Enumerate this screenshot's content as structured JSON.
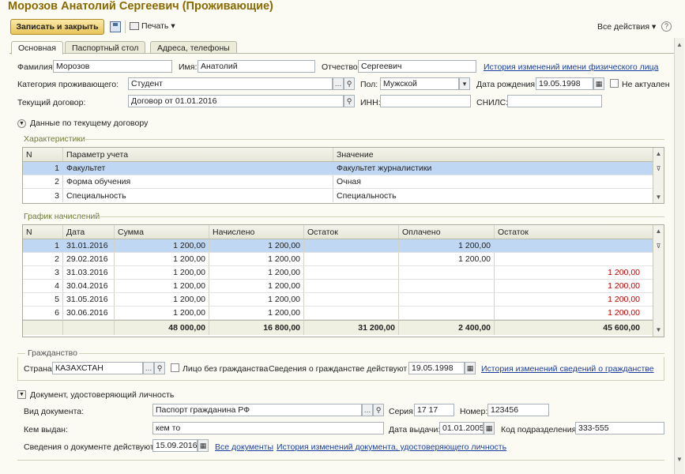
{
  "title": "Морозов Анатолий Сергеевич (Проживающие)",
  "toolbar": {
    "save_close": "Записать и закрыть",
    "print": "Печать",
    "all_actions": "Все действия",
    "help": "?"
  },
  "tabs": [
    "Основная",
    "Паспортный стол",
    "Адреса, телефоны"
  ],
  "person": {
    "lastname_label": "Фамилия:",
    "lastname": "Морозов",
    "firstname_label": "Имя:",
    "firstname": "Анатолий",
    "patronymic_label": "Отчество:",
    "patronymic": "Сергеевич",
    "name_history_link": "История изменений имени физического лица",
    "category_label": "Категория проживающего:",
    "category": "Студент",
    "gender_label": "Пол:",
    "gender": "Мужской",
    "birth_label": "Дата рождения:",
    "birth": "19.05.1998",
    "inactive_label": "Не актуален",
    "contract_label": "Текущий договор:",
    "contract": "Договор  от 01.01.2016",
    "inn_label": "ИНН:",
    "inn": "",
    "snils_label": "СНИЛС:",
    "snils": ""
  },
  "contract_section": "Данные по текущему договору",
  "characteristics": {
    "title": "Характеристики",
    "headers": [
      "N",
      "Параметр учета",
      "Значение"
    ],
    "rows": [
      {
        "n": "1",
        "param": "Факультет",
        "value": "Факультет журналистики"
      },
      {
        "n": "2",
        "param": "Форма обучения",
        "value": "Очная"
      },
      {
        "n": "3",
        "param": "Специальность",
        "value": "Специальность"
      }
    ]
  },
  "schedule": {
    "title": "График начислений",
    "headers": [
      "N",
      "Дата",
      "Сумма",
      "Начислено",
      "Остаток",
      "Оплачено",
      "Остаток"
    ],
    "rows": [
      {
        "n": "1",
        "date": "31.01.2016",
        "sum": "1 200,00",
        "charged": "1 200,00",
        "rest1": "",
        "paid": "1 200,00",
        "rest2": ""
      },
      {
        "n": "2",
        "date": "29.02.2016",
        "sum": "1 200,00",
        "charged": "1 200,00",
        "rest1": "",
        "paid": "1 200,00",
        "rest2": ""
      },
      {
        "n": "3",
        "date": "31.03.2016",
        "sum": "1 200,00",
        "charged": "1 200,00",
        "rest1": "",
        "paid": "",
        "rest2": "1 200,00"
      },
      {
        "n": "4",
        "date": "30.04.2016",
        "sum": "1 200,00",
        "charged": "1 200,00",
        "rest1": "",
        "paid": "",
        "rest2": "1 200,00"
      },
      {
        "n": "5",
        "date": "31.05.2016",
        "sum": "1 200,00",
        "charged": "1 200,00",
        "rest1": "",
        "paid": "",
        "rest2": "1 200,00"
      },
      {
        "n": "6",
        "date": "30.06.2016",
        "sum": "1 200,00",
        "charged": "1 200,00",
        "rest1": "",
        "paid": "",
        "rest2": "1 200,00"
      }
    ],
    "totals": {
      "sum": "48 000,00",
      "charged": "16 800,00",
      "rest1": "31 200,00",
      "paid": "2 400,00",
      "rest2": "45 600,00"
    }
  },
  "citizenship": {
    "title": "Гражданство",
    "country_label": "Страна:",
    "country": "КАЗАХСТАН",
    "stateless_label": "Лицо без гражданства",
    "valid_label": "Сведения о гражданстве действуют с:",
    "valid_from": "19.05.1998",
    "history_link": "История изменений сведений о гражданстве"
  },
  "document": {
    "title": "Документ, удостоверяющий личность",
    "type_label": "Вид документа:",
    "type": "Паспорт гражданина РФ",
    "series_label": "Серия:",
    "series": "17 17",
    "number_label": "Номер:",
    "number": "123456",
    "issuer_label": "Кем выдан:",
    "issuer": "кем то",
    "issue_date_label": "Дата выдачи:",
    "issue_date": "01.01.2005",
    "dept_label": "Код подразделения:",
    "dept": "333-555",
    "valid_label": "Сведения о документе действуют с:",
    "valid_from": "15.09.2016",
    "all_docs_link": "Все документы",
    "history_link": "История изменений документа, удостоверяющего личность"
  }
}
